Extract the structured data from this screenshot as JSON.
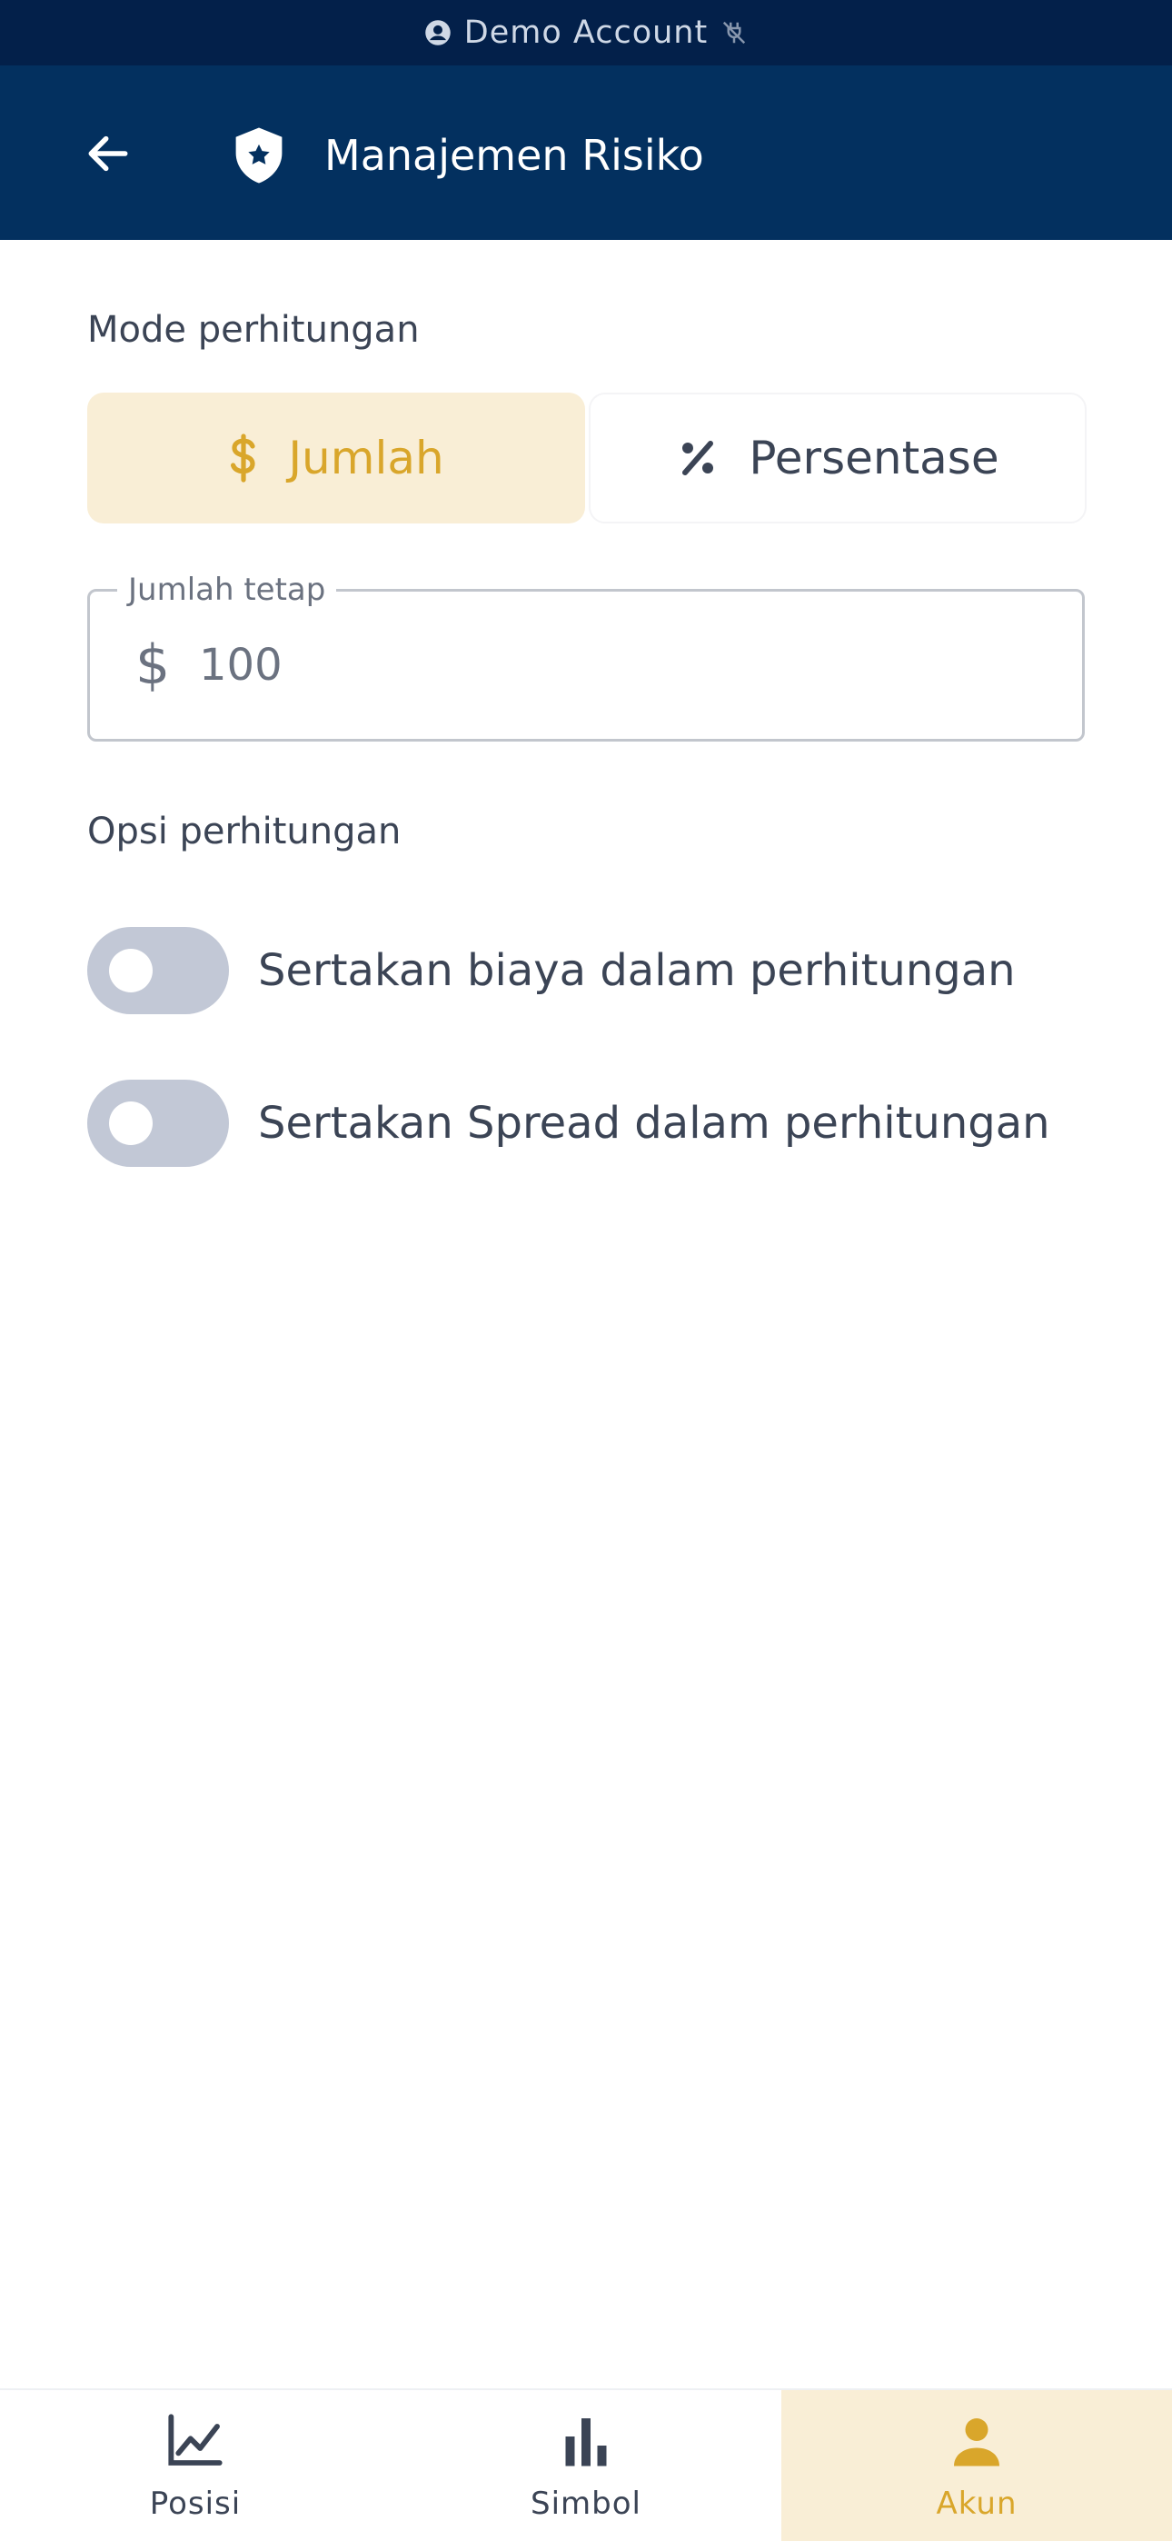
{
  "banner": {
    "text": "Demo Account"
  },
  "header": {
    "title": "Manajemen Risiko"
  },
  "mode_section": {
    "label": "Mode perhitungan",
    "options": [
      {
        "label": "Jumlah",
        "selected": true
      },
      {
        "label": "Persentase",
        "selected": false
      }
    ]
  },
  "fixed_amount": {
    "legend": "Jumlah tetap",
    "prefix": "$",
    "value": "100"
  },
  "calc_options": {
    "label": "Opsi perhitungan",
    "toggles": [
      {
        "label": "Sertakan biaya dalam perhitungan",
        "on": false
      },
      {
        "label": "Sertakan Spread dalam perhitungan",
        "on": false
      }
    ]
  },
  "bottom_nav": {
    "items": [
      {
        "label": "Posisi",
        "icon": "line-chart-icon",
        "active": false
      },
      {
        "label": "Simbol",
        "icon": "bar-chart-icon",
        "active": false
      },
      {
        "label": "Akun",
        "icon": "person-icon",
        "active": true
      }
    ]
  },
  "colors": {
    "banner_bg": "#03204a",
    "header_bg": "#03305f",
    "accent": "#d9a62b",
    "accent_bg": "#f9eed6",
    "toggle_off": "#c2c8d6"
  }
}
